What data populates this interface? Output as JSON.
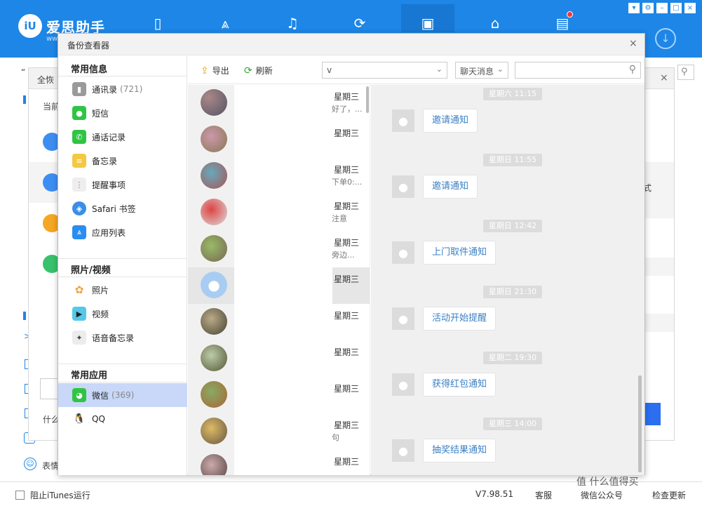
{
  "app": {
    "logo_short": "iU",
    "logo_text": "爱思助手",
    "logo_sub": "ww"
  },
  "background": {
    "search_prefix": "“",
    "dialog_title": "全恢",
    "dialog_row_label": "当前",
    "row_fragment": "式",
    "bottom_question": "什么",
    "left_fragment": "表情"
  },
  "bottombar": {
    "checkbox_label": "阻止iTunes运行",
    "version": "V7.98.51",
    "service": "客服",
    "wechat": "微信公众号",
    "update": "检查更新"
  },
  "viewer": {
    "title": "备份查看器",
    "close": "×"
  },
  "sidebar": {
    "section1": "常用信息",
    "section2": "照片/视频",
    "section3": "常用应用",
    "items": [
      {
        "label": "通讯录",
        "count": "(721)",
        "icon": "contacts-icon",
        "color": "#9a9a9a"
      },
      {
        "label": "短信",
        "count": "",
        "icon": "message-icon",
        "color": "#2fc544"
      },
      {
        "label": "通话记录",
        "count": "",
        "icon": "phone-icon",
        "color": "#2fc544"
      },
      {
        "label": "备忘录",
        "count": "",
        "icon": "notes-icon",
        "color": "#f5c842"
      },
      {
        "label": "提醒事项",
        "count": "",
        "icon": "reminders-icon",
        "color": "#e8e8e8"
      },
      {
        "label": "Safari 书签",
        "count": "",
        "icon": "safari-icon",
        "color": "#3a8ee6"
      },
      {
        "label": "应用列表",
        "count": "",
        "icon": "appstore-icon",
        "color": "#2a8ef0"
      },
      {
        "label": "照片",
        "count": "",
        "icon": "photos-icon",
        "color": "#f2a03d"
      },
      {
        "label": "视频",
        "count": "",
        "icon": "video-icon",
        "color": "#55c8e8"
      },
      {
        "label": "语音备忘录",
        "count": "",
        "icon": "voice-memo-icon",
        "color": "#ececec"
      },
      {
        "label": "微信",
        "count": "(369)",
        "icon": "wechat-icon",
        "color": "#2fc544"
      },
      {
        "label": "QQ",
        "count": "",
        "icon": "qq-icon",
        "color": "#ffffff"
      }
    ]
  },
  "toolbar": {
    "export": "导出",
    "refresh": "刷新",
    "account_select": "v",
    "type_select": "聊天消息",
    "search_placeholder": ""
  },
  "contacts": [
    {
      "day": "星期三",
      "snippet": "好了，..."
    },
    {
      "day": "星期三",
      "snippet": ""
    },
    {
      "day": "星期三",
      "snippet": "下单0:..."
    },
    {
      "day": "星期三",
      "snippet": "注意"
    },
    {
      "day": "星期三",
      "snippet": "旁边..."
    },
    {
      "day": "星期三",
      "snippet": ""
    },
    {
      "day": "星期三",
      "snippet": ""
    },
    {
      "day": "星期三",
      "snippet": ""
    },
    {
      "day": "星期三",
      "snippet": ""
    },
    {
      "day": "星期三",
      "snippet": "句"
    },
    {
      "day": "星期三",
      "snippet": ""
    }
  ],
  "messages": [
    {
      "time": "星期六 11:15",
      "text": "邀请通知"
    },
    {
      "time": "星期日 11:55",
      "text": "邀请通知"
    },
    {
      "time": "星期日 12:42",
      "text": "上门取件通知"
    },
    {
      "time": "星期日 21:30",
      "text": "活动开始提醒"
    },
    {
      "time": "星期二 19:30",
      "text": "获得红包通知"
    },
    {
      "time": "星期三 14:00",
      "text": "抽奖结果通知"
    }
  ],
  "watermark": "值 什么值得买"
}
